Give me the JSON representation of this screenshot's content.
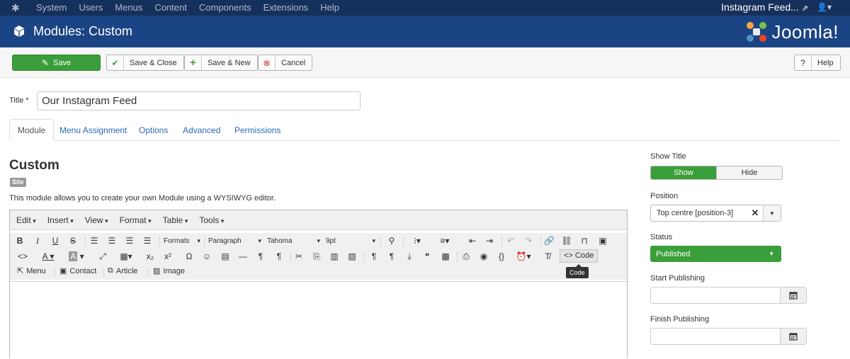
{
  "topbar": {
    "menu": [
      "System",
      "Users",
      "Menus",
      "Content",
      "Components",
      "Extensions",
      "Help"
    ],
    "site_link": "Instagram Feed..."
  },
  "header": {
    "title": "Modules: Custom",
    "brand": "Joomla!"
  },
  "toolbar": {
    "save": "Save",
    "save_close": "Save & Close",
    "save_new": "Save & New",
    "cancel": "Cancel",
    "help": "Help"
  },
  "form": {
    "title_label": "Title *",
    "title_value": "Our Instagram Feed"
  },
  "tabs": [
    "Module",
    "Menu Assignment",
    "Options",
    "Advanced",
    "Permissions"
  ],
  "module": {
    "heading": "Custom",
    "badge": "Site",
    "description": "This module allows you to create your own Module using a WYSIWYG editor."
  },
  "editor": {
    "menus": [
      "Edit",
      "Insert",
      "View",
      "Format",
      "Table",
      "Tools"
    ],
    "formats": "Formats",
    "block": "Paragraph",
    "font": "Tahoma",
    "size": "9pt",
    "code_button": "Code",
    "tooltip": "Code",
    "inserts": [
      "Menu",
      "Contact",
      "Article",
      "Image"
    ]
  },
  "sidebar": {
    "show_title_label": "Show Title",
    "show": "Show",
    "hide": "Hide",
    "position_label": "Position",
    "position_value": "Top centre [position-3]",
    "status_label": "Status",
    "status_value": "Published",
    "start_label": "Start Publishing",
    "finish_label": "Finish Publishing"
  },
  "colors": {
    "topbar": "#15305b",
    "header": "#1b4484",
    "success": "#3a9e3a",
    "link": "#2a69b8"
  }
}
